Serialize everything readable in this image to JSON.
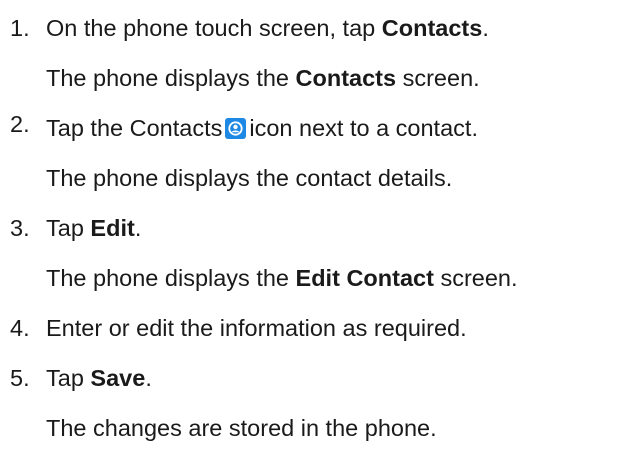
{
  "steps": [
    {
      "number": "1.",
      "instruction": {
        "before": "On the phone touch screen, tap ",
        "bold": "Contacts",
        "after": "."
      },
      "result": {
        "before": "The phone displays the ",
        "bold": "Contacts",
        "after": " screen."
      }
    },
    {
      "number": "2.",
      "instruction": {
        "before": "Tap the Contacts",
        "icon": "contacts-icon",
        "after": "icon next to a contact."
      },
      "result": {
        "text": "The phone displays the contact details."
      }
    },
    {
      "number": "3.",
      "instruction": {
        "before": "Tap ",
        "bold": "Edit",
        "after": "."
      },
      "result": {
        "before": "The phone displays the ",
        "bold": "Edit Contact",
        "after": " screen."
      }
    },
    {
      "number": "4.",
      "instruction": {
        "text": "Enter or edit the information as required."
      }
    },
    {
      "number": "5.",
      "instruction": {
        "before": "Tap ",
        "bold": "Save",
        "after": "."
      },
      "result": {
        "text": "The changes are stored in the phone."
      }
    }
  ],
  "colors": {
    "text": "#1a1a1a",
    "icon_bg": "#1e88e5",
    "icon_fg": "#ffffff"
  }
}
